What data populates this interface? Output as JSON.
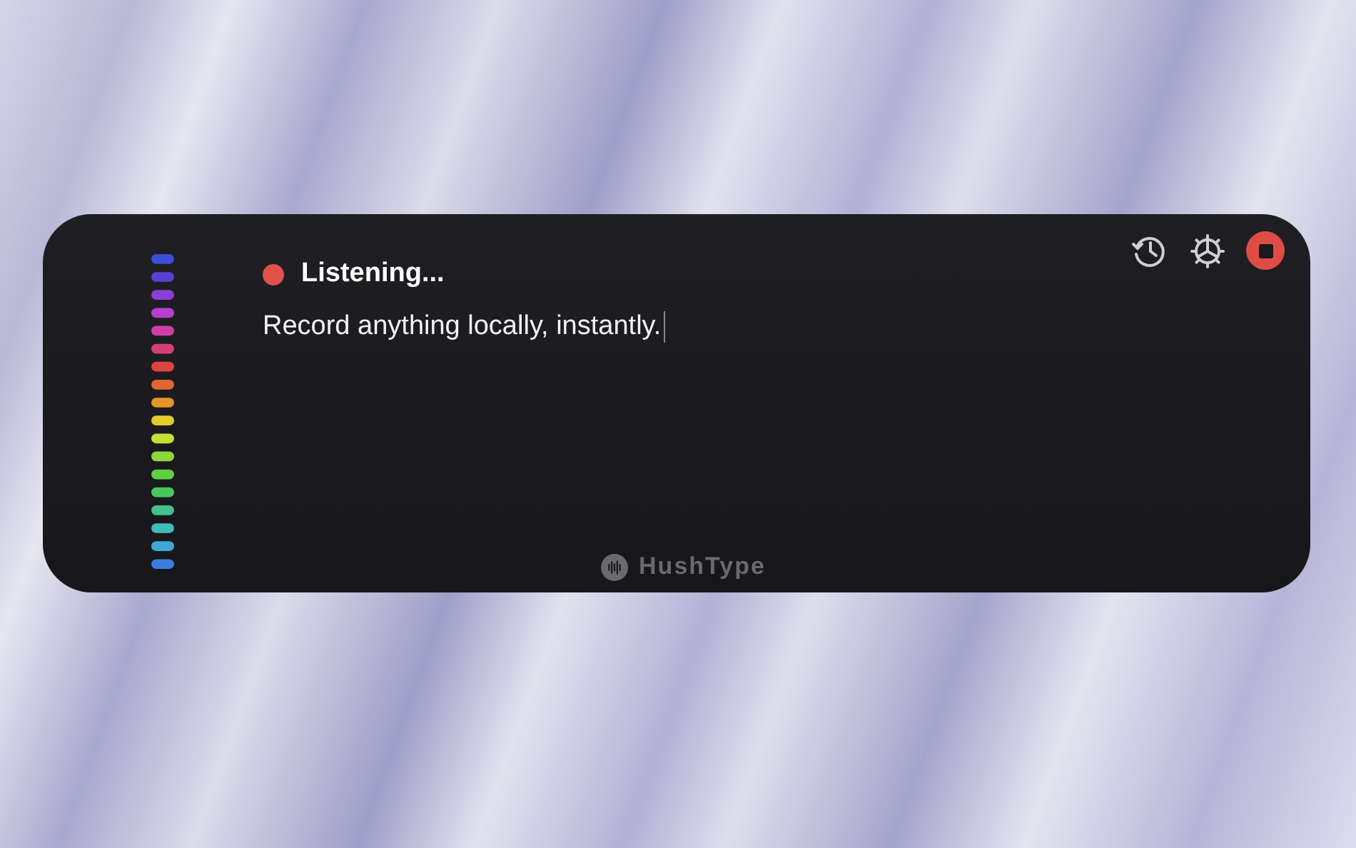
{
  "status": {
    "text": "Listening...",
    "recording": true
  },
  "transcript": {
    "text": "Record anything locally, instantly."
  },
  "toolbar": [
    {
      "kind": "history"
    },
    {
      "kind": "settings"
    },
    {
      "kind": "stop"
    }
  ],
  "brand": {
    "name": "HushType"
  }
}
